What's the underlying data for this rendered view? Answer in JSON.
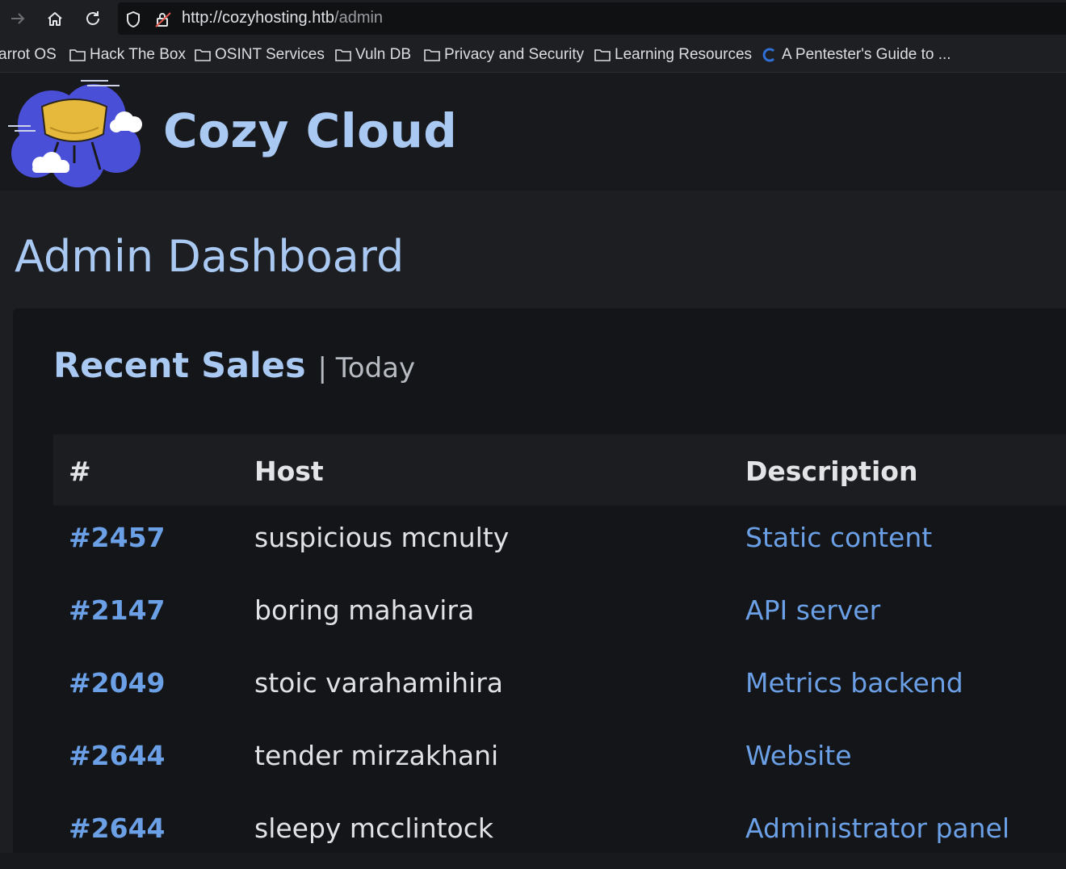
{
  "browser": {
    "url_host": "http://cozyhosting.htb",
    "url_path": "/admin",
    "bookmarks": [
      "arrot OS",
      "Hack The Box",
      "OSINT Services",
      "Vuln DB",
      "Privacy and Security",
      "Learning Resources",
      "A Pentester's Guide to ..."
    ]
  },
  "site": {
    "brand": "Cozy Cloud"
  },
  "page": {
    "title": "Admin Dashboard"
  },
  "sales": {
    "title": "Recent Sales",
    "subtitle": "| Today",
    "columns": [
      "#",
      "Host",
      "Description"
    ],
    "rows": [
      {
        "id": "#2457",
        "host": "suspicious mcnulty",
        "description": "Static content"
      },
      {
        "id": "#2147",
        "host": "boring mahavira",
        "description": "API server"
      },
      {
        "id": "#2049",
        "host": "stoic varahamihira",
        "description": "Metrics backend"
      },
      {
        "id": "#2644",
        "host": "tender mirzakhani",
        "description": "Website"
      },
      {
        "id": "#2644",
        "host": "sleepy mcclintock",
        "description": "Administrator panel"
      }
    ]
  },
  "colors": {
    "accent": "#a9c8f2",
    "link": "#6b9fe6",
    "background": "#17191c"
  }
}
